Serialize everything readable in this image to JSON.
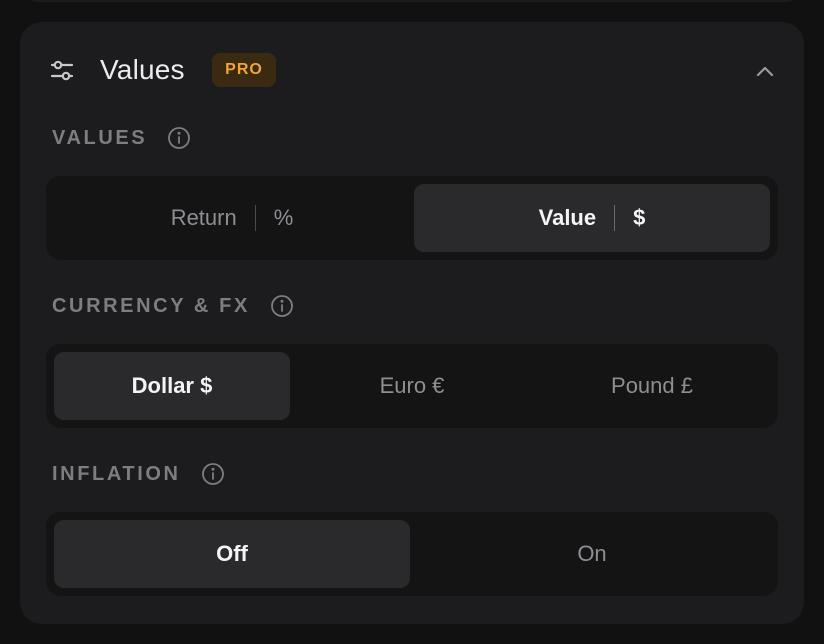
{
  "header": {
    "title": "Values",
    "badge": "PRO",
    "icon": "sliders-icon",
    "collapse_icon": "chevron-up-icon"
  },
  "sections": [
    {
      "label": "VALUES",
      "options": [
        {
          "label": "Return",
          "unit": "%",
          "active": false
        },
        {
          "label": "Value",
          "unit": "$",
          "active": true
        }
      ]
    },
    {
      "label": "CURRENCY & FX",
      "options": [
        {
          "label": "Dollar $",
          "active": true
        },
        {
          "label": "Euro €",
          "active": false
        },
        {
          "label": "Pound £",
          "active": false
        }
      ]
    },
    {
      "label": "INFLATION",
      "options": [
        {
          "label": "Off",
          "active": true
        },
        {
          "label": "On",
          "active": false
        }
      ]
    }
  ],
  "colors": {
    "panel": "#1c1c1e",
    "segment_track": "#141415",
    "segment_active": "#2a2a2d",
    "badge_bg": "#3a2a12",
    "badge_text": "#f0a43a"
  }
}
